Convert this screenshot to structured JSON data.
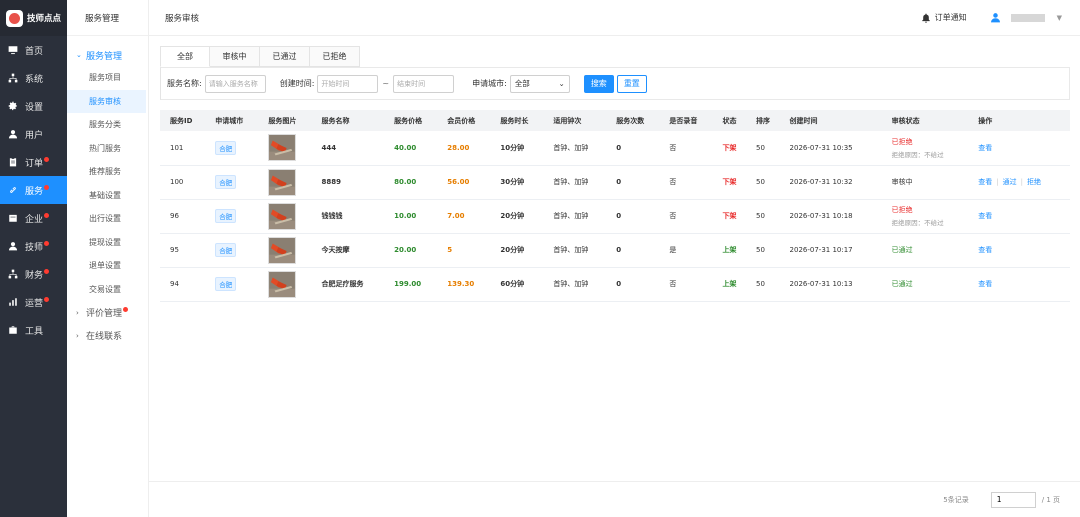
{
  "brand": {
    "name": "技师点点"
  },
  "nav": [
    {
      "label": "首页",
      "icon": "monitor-icon",
      "dot": false
    },
    {
      "label": "系统",
      "icon": "sitemap-icon",
      "dot": false
    },
    {
      "label": "设置",
      "icon": "gear-icon",
      "dot": false
    },
    {
      "label": "用户",
      "icon": "user-icon",
      "dot": false
    },
    {
      "label": "订单",
      "icon": "clipboard-icon",
      "dot": true
    },
    {
      "label": "服务",
      "icon": "link-icon",
      "dot": true,
      "active": true
    },
    {
      "label": "企业",
      "icon": "building-icon",
      "dot": true
    },
    {
      "label": "技师",
      "icon": "user-icon",
      "dot": true
    },
    {
      "label": "财务",
      "icon": "sitemap-icon",
      "dot": true
    },
    {
      "label": "运营",
      "icon": "chart-icon",
      "dot": true
    },
    {
      "label": "工具",
      "icon": "briefcase-icon",
      "dot": false
    }
  ],
  "subnav": {
    "header": "服务管理",
    "group_open": "服务管理",
    "items": [
      "服务项目",
      "服务审核",
      "服务分类",
      "热门服务",
      "推荐服务",
      "基础设置",
      "出行设置",
      "提现设置",
      "退单设置",
      "交易设置"
    ],
    "active_index": 1,
    "group_review": "评价管理",
    "group_contact": "在线联系"
  },
  "header": {
    "breadcrumb": "服务审核",
    "notify_label": "订单通知"
  },
  "tabs": [
    "全部",
    "审核中",
    "已通过",
    "已拒绝"
  ],
  "filter": {
    "name_label": "服务名称:",
    "name_placeholder": "请输入服务名称",
    "time_label": "创建时间:",
    "start_placeholder": "开始时间",
    "range_sep": "~",
    "end_placeholder": "结束时间",
    "city_label": "申请城市:",
    "city_value": "全部",
    "search_btn": "搜索",
    "reset_btn": "重置"
  },
  "table": {
    "columns": [
      "服务ID",
      "申请城市",
      "服务图片",
      "服务名称",
      "服务价格",
      "会员价格",
      "服务时长",
      "适用钟次",
      "服务次数",
      "是否录音",
      "状态",
      "排序",
      "创建时间",
      "审核状态",
      "操作"
    ],
    "rows": [
      {
        "id": "101",
        "city": "合肥",
        "name": "444",
        "price": "40.00",
        "member_price": "28.00",
        "duration": "10分钟",
        "clock": "首钟、加钟",
        "count": "0",
        "record": "否",
        "status": "下架",
        "status_type": "off",
        "sort": "50",
        "created": "2026-07-31 10:35",
        "audit": "已拒绝",
        "audit_type": "rej",
        "reason": "拒绝原因：不给过",
        "ops": [
          "查看"
        ]
      },
      {
        "id": "100",
        "city": "合肥",
        "name": "8889",
        "price": "80.00",
        "member_price": "56.00",
        "duration": "30分钟",
        "clock": "首钟、加钟",
        "count": "0",
        "record": "否",
        "status": "下架",
        "status_type": "off",
        "sort": "50",
        "created": "2026-07-31 10:32",
        "audit": "审核中",
        "audit_type": "pending",
        "reason": "",
        "ops": [
          "查看",
          "通过",
          "拒绝"
        ]
      },
      {
        "id": "96",
        "city": "合肥",
        "name": "钱钱钱",
        "price": "10.00",
        "member_price": "7.00",
        "duration": "20分钟",
        "clock": "首钟、加钟",
        "count": "0",
        "record": "否",
        "status": "下架",
        "status_type": "off",
        "sort": "50",
        "created": "2026-07-31 10:18",
        "audit": "已拒绝",
        "audit_type": "rej",
        "reason": "拒绝原因：不给过",
        "ops": [
          "查看"
        ]
      },
      {
        "id": "95",
        "city": "合肥",
        "name": "今天按摩",
        "price": "20.00",
        "member_price": "5",
        "duration": "20分钟",
        "clock": "首钟、加钟",
        "count": "0",
        "record": "是",
        "status": "上架",
        "status_type": "on",
        "sort": "50",
        "created": "2026-07-31 10:17",
        "audit": "已通过",
        "audit_type": "pass",
        "reason": "",
        "ops": [
          "查看"
        ]
      },
      {
        "id": "94",
        "city": "合肥",
        "name": "合肥足疗服务",
        "price": "199.00",
        "member_price": "139.30",
        "duration": "60分钟",
        "clock": "首钟、加钟",
        "count": "0",
        "record": "否",
        "status": "上架",
        "status_type": "on",
        "sort": "50",
        "created": "2026-07-31 10:13",
        "audit": "已通过",
        "audit_type": "pass",
        "reason": "",
        "ops": [
          "查看"
        ]
      }
    ]
  },
  "footer": {
    "total": "5条记录",
    "page": "1",
    "page_total": "/ 1 页"
  }
}
